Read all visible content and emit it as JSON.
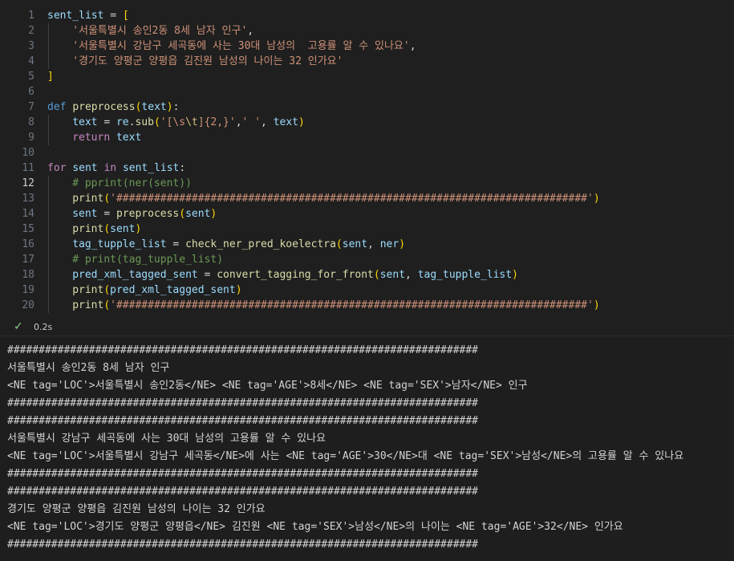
{
  "code_lines": [
    {
      "num": "1",
      "active": false,
      "indent": 0,
      "tokens": [
        [
          "v",
          "sent_list"
        ],
        [
          "p",
          " = "
        ],
        [
          "br1",
          "["
        ]
      ]
    },
    {
      "num": "2",
      "active": false,
      "indent": 1,
      "tokens": [
        [
          "s",
          "'서울특별시 송인2동 8세 남자 인구'"
        ],
        [
          "p",
          ","
        ]
      ]
    },
    {
      "num": "3",
      "active": false,
      "indent": 1,
      "tokens": [
        [
          "s",
          "'서울특별시 강남구 세곡동에 사는 30대 남성의  고용률 알 수 있나요'"
        ],
        [
          "p",
          ","
        ]
      ]
    },
    {
      "num": "4",
      "active": false,
      "indent": 1,
      "tokens": [
        [
          "s",
          "'경기도 양평군 양평읍 김진원 남성의 나이는 32 인가요'"
        ]
      ]
    },
    {
      "num": "5",
      "active": false,
      "indent": 0,
      "tokens": [
        [
          "br1",
          "]"
        ]
      ]
    },
    {
      "num": "6",
      "active": false,
      "indent": 0,
      "tokens": []
    },
    {
      "num": "7",
      "active": false,
      "indent": 0,
      "tokens": [
        [
          "kd",
          "def "
        ],
        [
          "f",
          "preprocess"
        ],
        [
          "br1",
          "("
        ],
        [
          "v",
          "text"
        ],
        [
          "br1",
          ")"
        ],
        [
          "p",
          ":"
        ]
      ]
    },
    {
      "num": "8",
      "active": false,
      "indent": 1,
      "tokens": [
        [
          "v",
          "text"
        ],
        [
          "p",
          " = "
        ],
        [
          "v",
          "re"
        ],
        [
          "p",
          "."
        ],
        [
          "f",
          "sub"
        ],
        [
          "br1",
          "("
        ],
        [
          "s",
          "'[\\s"
        ],
        [
          "esc",
          "\\t"
        ],
        [
          "s",
          "]{2,}'"
        ],
        [
          "p",
          ","
        ],
        [
          "s",
          "' '"
        ],
        [
          "p",
          ", "
        ],
        [
          "v",
          "text"
        ],
        [
          "br1",
          ")"
        ]
      ]
    },
    {
      "num": "9",
      "active": false,
      "indent": 1,
      "tokens": [
        [
          "k",
          "return "
        ],
        [
          "v",
          "text"
        ]
      ]
    },
    {
      "num": "10",
      "active": false,
      "indent": 0,
      "tokens": []
    },
    {
      "num": "11",
      "active": false,
      "indent": 0,
      "tokens": [
        [
          "k",
          "for "
        ],
        [
          "v",
          "sent "
        ],
        [
          "k",
          "in "
        ],
        [
          "v",
          "sent_list"
        ],
        [
          "p",
          ":"
        ]
      ]
    },
    {
      "num": "12",
      "active": true,
      "indent": 1,
      "tokens": [
        [
          "c",
          "# pprint(ner(sent))"
        ]
      ]
    },
    {
      "num": "13",
      "active": false,
      "indent": 1,
      "tokens": [
        [
          "f",
          "print"
        ],
        [
          "br1",
          "("
        ],
        [
          "s",
          "'###########################################################################'"
        ],
        [
          "br1",
          ")"
        ]
      ]
    },
    {
      "num": "14",
      "active": false,
      "indent": 1,
      "tokens": [
        [
          "v",
          "sent"
        ],
        [
          "p",
          " = "
        ],
        [
          "f",
          "preprocess"
        ],
        [
          "br1",
          "("
        ],
        [
          "v",
          "sent"
        ],
        [
          "br1",
          ")"
        ]
      ]
    },
    {
      "num": "15",
      "active": false,
      "indent": 1,
      "tokens": [
        [
          "f",
          "print"
        ],
        [
          "br1",
          "("
        ],
        [
          "v",
          "sent"
        ],
        [
          "br1",
          ")"
        ]
      ]
    },
    {
      "num": "16",
      "active": false,
      "indent": 1,
      "tokens": [
        [
          "v",
          "tag_tupple_list"
        ],
        [
          "p",
          " = "
        ],
        [
          "f",
          "check_ner_pred_koelectra"
        ],
        [
          "br1",
          "("
        ],
        [
          "v",
          "sent"
        ],
        [
          "p",
          ", "
        ],
        [
          "v",
          "ner"
        ],
        [
          "br1",
          ")"
        ]
      ]
    },
    {
      "num": "17",
      "active": false,
      "indent": 1,
      "tokens": [
        [
          "c",
          "# print(tag_tupple_list)"
        ]
      ]
    },
    {
      "num": "18",
      "active": false,
      "indent": 1,
      "tokens": [
        [
          "v",
          "pred_xml_tagged_sent"
        ],
        [
          "p",
          " = "
        ],
        [
          "f",
          "convert_tagging_for_front"
        ],
        [
          "br1",
          "("
        ],
        [
          "v",
          "sent"
        ],
        [
          "p",
          ", "
        ],
        [
          "v",
          "tag_tupple_list"
        ],
        [
          "br1",
          ")"
        ]
      ]
    },
    {
      "num": "19",
      "active": false,
      "indent": 1,
      "tokens": [
        [
          "f",
          "print"
        ],
        [
          "br1",
          "("
        ],
        [
          "v",
          "pred_xml_tagged_sent"
        ],
        [
          "br1",
          ")"
        ]
      ]
    },
    {
      "num": "20",
      "active": false,
      "indent": 1,
      "tokens": [
        [
          "f",
          "print"
        ],
        [
          "br1",
          "("
        ],
        [
          "s",
          "'###########################################################################'"
        ],
        [
          "br1",
          ")"
        ]
      ]
    }
  ],
  "status": {
    "check_icon": "check-icon",
    "time": "0.2s",
    "color": "#89d185"
  },
  "output_lines": [
    "###########################################################################",
    "서울특별시 송인2동 8세 남자 인구",
    "<NE tag='LOC'>서울특별시 송인2동</NE> <NE tag='AGE'>8세</NE> <NE tag='SEX'>남자</NE> 인구",
    "###########################################################################",
    "###########################################################################",
    "서울특별시 강남구 세곡동에 사는 30대 남성의 고용률 알 수 있나요",
    "<NE tag='LOC'>서울특별시 강남구 세곡동</NE>에 사는 <NE tag='AGE'>30</NE>대 <NE tag='SEX'>남성</NE>의 고용률 알 수 있나요",
    "###########################################################################",
    "###########################################################################",
    "경기도 양평군 양평읍 김진원 남성의 나이는 32 인가요",
    "<NE tag='LOC'>경기도 양평군 양평읍</NE> 김진원 <NE tag='SEX'>남성</NE>의 나이는 <NE tag='AGE'>32</NE> 인가요",
    "###########################################################################"
  ]
}
